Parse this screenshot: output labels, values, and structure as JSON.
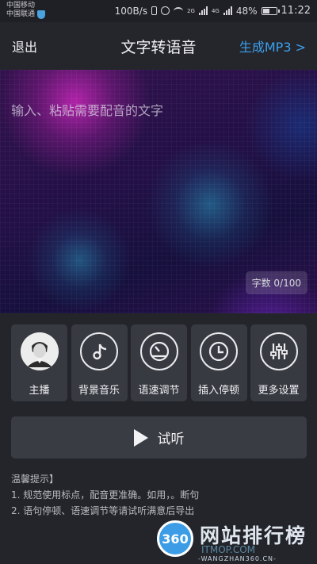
{
  "status_bar": {
    "carrier_1": "中国移动",
    "carrier_2": "中国联通",
    "net_speed": "100B/s",
    "signal_1_tag": "2G",
    "signal_2_tag": "4G",
    "battery_percent": "48%",
    "time": "11:22"
  },
  "header": {
    "back_label": "退出",
    "title": "文字转语音",
    "action_label": "生成MP3 >",
    "action_color": "#3aa0ef"
  },
  "editor": {
    "placeholder": "输入、粘贴需要配音的文字",
    "char_count": "字数 0/100"
  },
  "tools": [
    {
      "label": "主播",
      "icon": "anchor-avatar-icon"
    },
    {
      "label": "背景音乐",
      "icon": "music-note-icon"
    },
    {
      "label": "语速调节",
      "icon": "speedometer-icon"
    },
    {
      "label": "插入停顿",
      "icon": "clock-icon"
    },
    {
      "label": "更多设置",
      "icon": "sliders-icon"
    }
  ],
  "listen_button": {
    "label": "试听",
    "icon": "play-icon"
  },
  "tips": {
    "title": "温馨提示】",
    "line_1": "1. 规范使用标点，配音更准确。如用，。断句",
    "line_2": "2. 语句停顿、语速调节等请试听满意后导出"
  },
  "watermark": {
    "logo_text": "360",
    "title": "网站排行榜",
    "sub": "ITMOP.COM",
    "url": "-WANGZHAN360.CN-"
  }
}
